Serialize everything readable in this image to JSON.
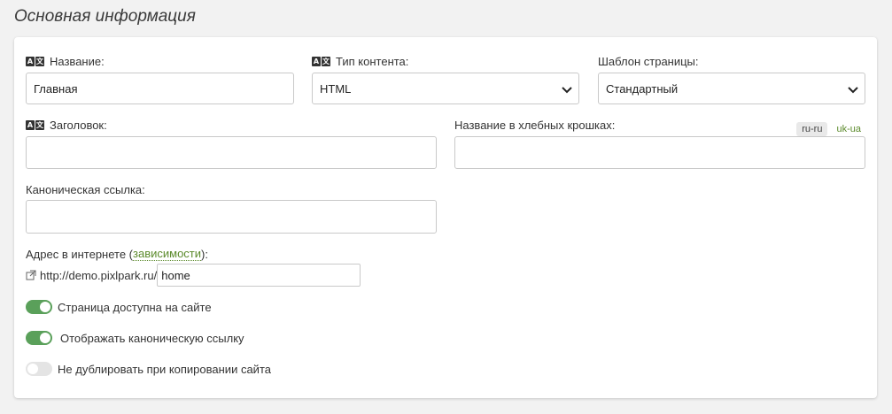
{
  "section": {
    "title": "Основная информация"
  },
  "fields": {
    "name": {
      "label": "Название:",
      "value": "Главная"
    },
    "content_type": {
      "label": "Тип контента:",
      "value": "HTML"
    },
    "template": {
      "label": "Шаблон страницы:",
      "value": "Стандартный"
    },
    "heading": {
      "label": "Заголовок:",
      "value": ""
    },
    "breadcrumb_name": {
      "label": "Название в хлебных крошках:",
      "value": ""
    },
    "canonical": {
      "label": "Каноническая ссылка:",
      "value": ""
    },
    "address": {
      "label_prefix": "Адрес в интернете (",
      "dependencies_link": "зависимости",
      "label_suffix": "):",
      "url_prefix": "http://demo.pixlpark.ru/",
      "slug": "home"
    }
  },
  "translate_badge": {
    "left": "A",
    "right": "文"
  },
  "languages": {
    "active": "ru-ru",
    "inactive": "uk-ua"
  },
  "toggles": {
    "available": {
      "label": "Страница доступна на сайте",
      "state": "on"
    },
    "show_canonical": {
      "label": "Отображать каноническую ссылку",
      "state": "on"
    },
    "no_duplicate": {
      "label": "Не дублировать при копировании сайта",
      "state": "off"
    }
  },
  "colors": {
    "accent_green": "#5aa05a",
    "link_green": "#5b8a2b"
  },
  "icons": {
    "translate": "translate-icon",
    "external_link": "external-link-icon",
    "chevron": "chevron-down-icon"
  }
}
